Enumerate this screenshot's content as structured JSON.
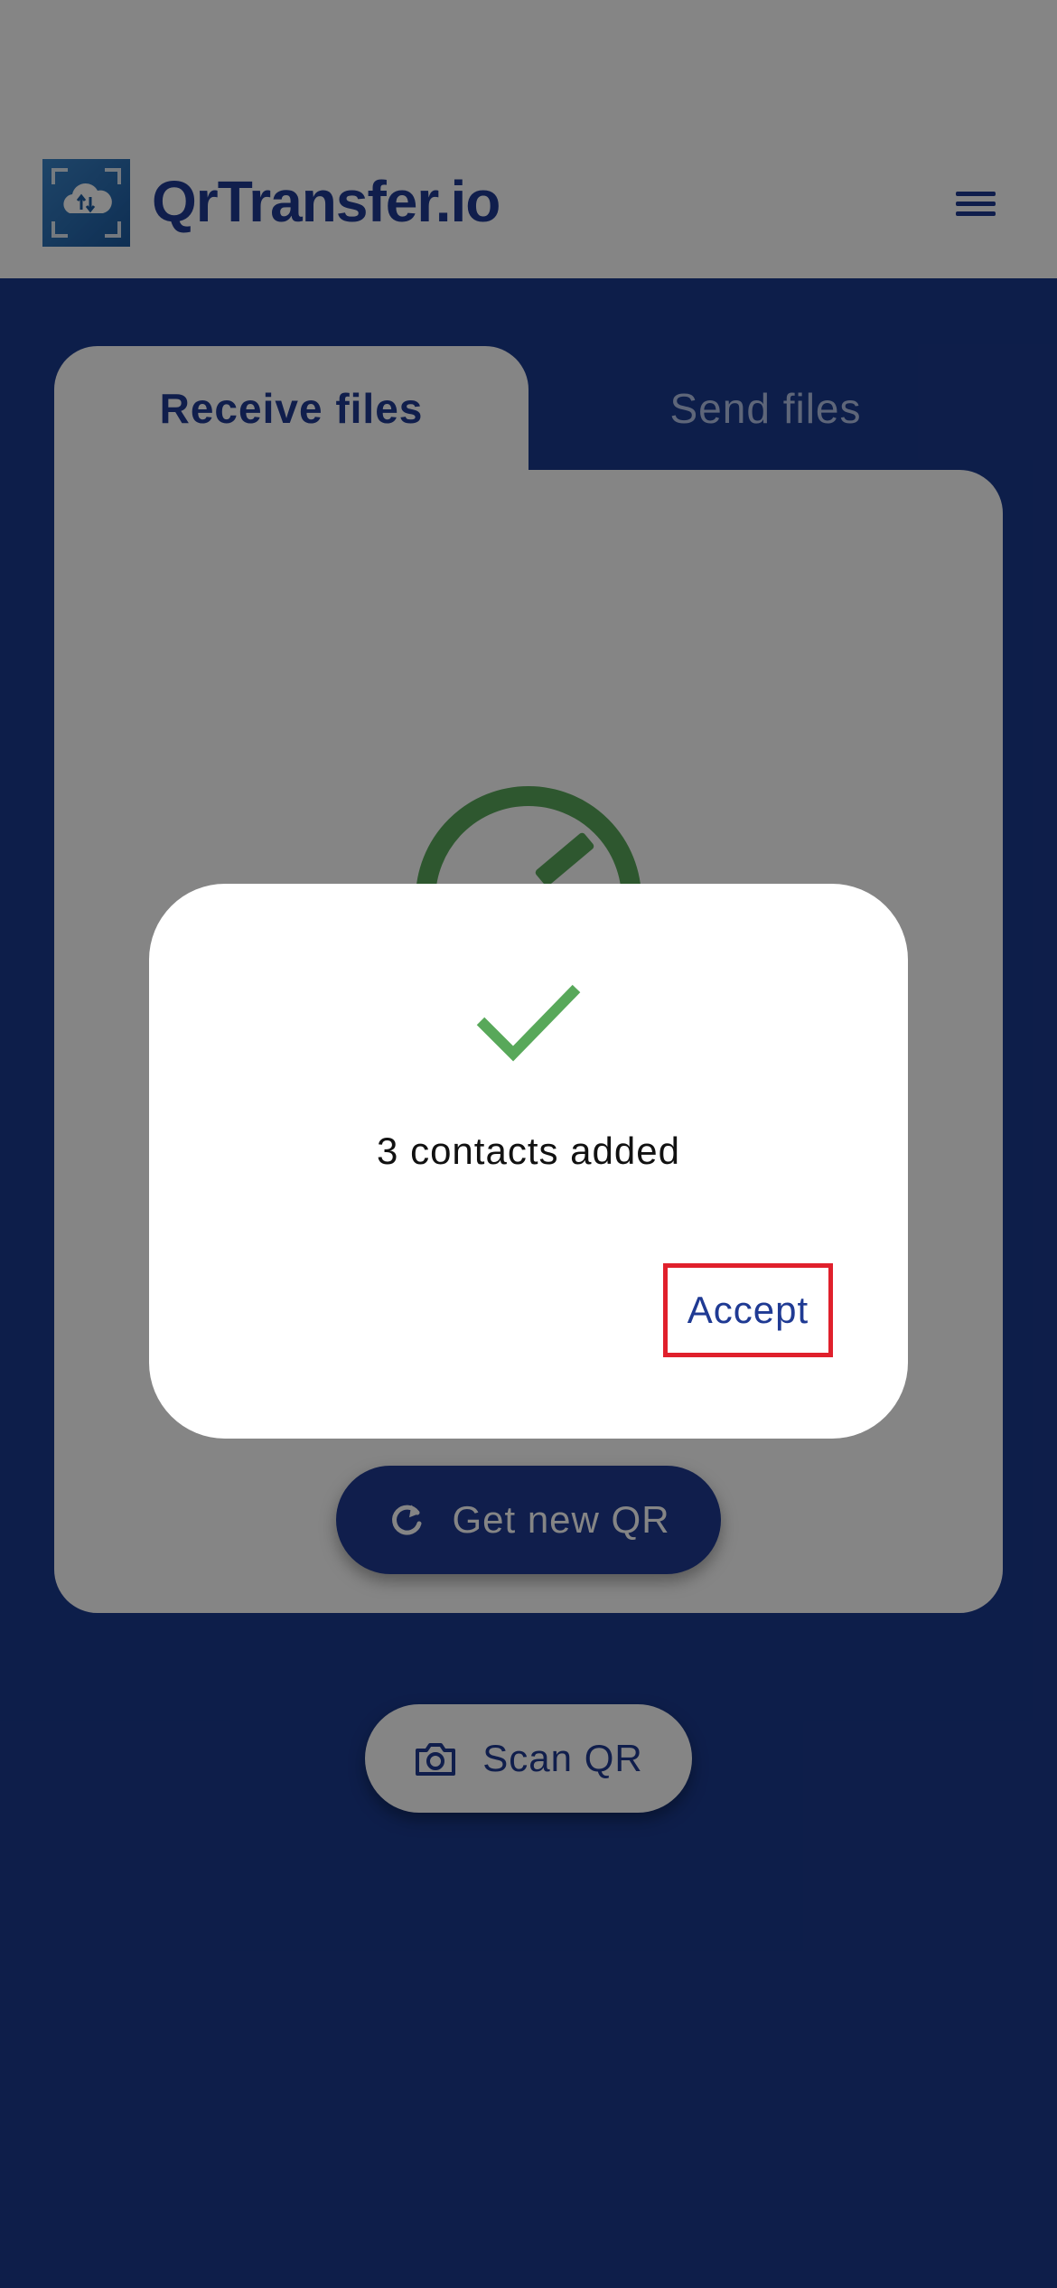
{
  "header": {
    "brand": "QrTransfer.io",
    "logo_icon": "cloud-transfer-icon",
    "menu_icon": "hamburger-menu-icon"
  },
  "tabs": [
    {
      "label": "Receive files",
      "active": true
    },
    {
      "label": "Send files",
      "active": false
    }
  ],
  "card": {
    "success_icon": "check-circle-icon",
    "get_new_qr_label": "Get new QR",
    "get_new_qr_icon": "refresh-icon"
  },
  "scan": {
    "label": "Scan QR",
    "icon": "camera-icon"
  },
  "dialog": {
    "icon": "checkmark-icon",
    "message": "3 contacts added",
    "accept_label": "Accept"
  },
  "colors": {
    "brand_blue": "#1f3a93",
    "success_green": "#58a85a",
    "highlight_red": "#e0202c"
  }
}
